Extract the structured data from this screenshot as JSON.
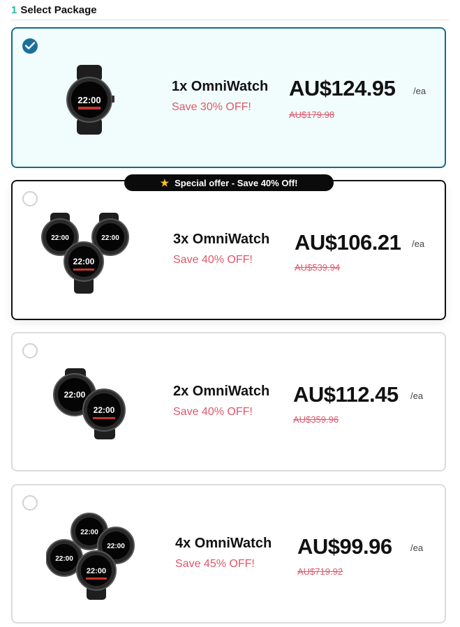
{
  "step": {
    "number": "1",
    "title": "Select Package"
  },
  "special_badge": {
    "icon": "star-icon",
    "text": "Special offer - Save 40% Off!"
  },
  "packages": [
    {
      "title": "1x OmniWatch",
      "save": "Save 30% OFF!",
      "price": "AU$124.95",
      "per": "/ea",
      "original": "AU$179.98",
      "selected": true
    },
    {
      "title": "3x OmniWatch",
      "save": "Save 40% OFF!",
      "price": "AU$106.21",
      "per": "/ea",
      "original": "AU$539.94",
      "selected": false
    },
    {
      "title": "2x OmniWatch",
      "save": "Save 40% OFF!",
      "price": "AU$112.45",
      "per": "/ea",
      "original": "AU$359.96",
      "selected": false
    },
    {
      "title": "4x OmniWatch",
      "save": "Save 45% OFF!",
      "price": "AU$99.96",
      "per": "/ea",
      "original": "AU$719.92",
      "selected": false
    }
  ],
  "watch_face": {
    "time": "22:00"
  },
  "colors": {
    "selected_border": "#16688f",
    "selected_bg": "#f1fdfc",
    "save_text": "#e0576b",
    "step_number": "#2bb5a0"
  }
}
